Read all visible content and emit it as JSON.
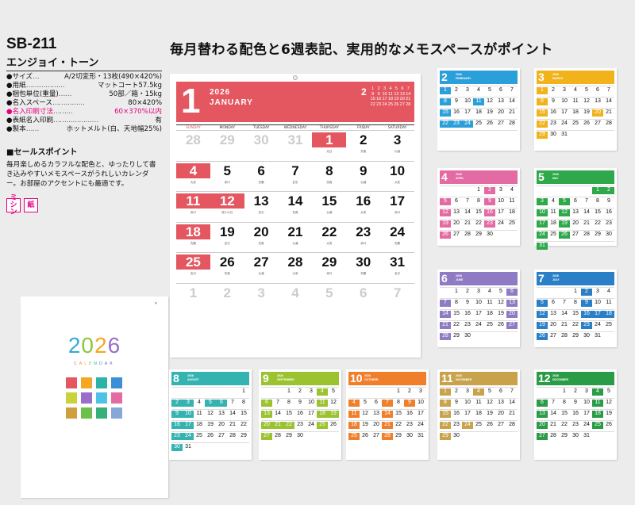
{
  "product": {
    "model": "SB-211",
    "name": "エンジョイ・トーン",
    "specs": [
      {
        "k": "●サイズ",
        "d": "…",
        "v": "A/2切変形・13枚(490×420%)"
      },
      {
        "k": "●用紙",
        "d": "………………",
        "v": "マットコート57.5kg"
      },
      {
        "k": "●梱包単位(重量)",
        "d": "……",
        "v": "50部／箱・15kg"
      },
      {
        "k": "●名入スペース",
        "d": "……………",
        "v": "80×420%"
      },
      {
        "k": "●名入印刷寸法",
        "d": "………",
        "v": "60×370%以内",
        "highlight": true
      },
      {
        "k": "●表紙名入印刷",
        "d": "…………………",
        "v": "有"
      },
      {
        "k": "●製本",
        "d": "……",
        "v": "ホットメルト(白、天地幅25%)"
      }
    ],
    "selling_point_title": "■セールスポイント",
    "selling_point_text": "毎月楽しめるカラフルな配色と、ゆったりして書き込みやすいメモスペースがうれしいカレンダー。お部屋のアクセントにも最適です。",
    "icons": [
      "ミシン",
      "紙"
    ]
  },
  "headline": "毎月替わる配色と6週表記、実用的なメモスペースがポイント",
  "cover": {
    "year": "2026",
    "year_colors": [
      "#3aa9d6",
      "#8cc63f",
      "#f4a71d",
      "#9b6fc9"
    ],
    "calendar_label": "CALENDAR",
    "label_colors": [
      "#e45761",
      "#f08a2e",
      "#f4c21d",
      "#8cc63f",
      "#2bb3a7",
      "#3a8fd6",
      "#5a6fd1",
      "#9b6fc9"
    ],
    "swatches": [
      "#e45761",
      "#f5a623",
      "#2bb3a7",
      "#3a8fd6",
      "#c9d23a",
      "#9b6fc9",
      "#4fc3e6",
      "#e46aa4",
      "#cf9f3c",
      "#6bbf4a",
      "#35b07a",
      "#86a8d8"
    ]
  },
  "main_calendar": {
    "year": "2026",
    "month_num": "1",
    "month_name": "JANUARY",
    "color": "#e45761",
    "next_month_num": "2",
    "next_month_days": [
      "",
      "",
      "",
      "",
      "",
      "",
      "",
      "1",
      "2",
      "3",
      "4",
      "5",
      "6",
      "7",
      "8",
      "9",
      "10",
      "11",
      "12",
      "13",
      "14",
      "15",
      "16",
      "17",
      "18",
      "19",
      "20",
      "21",
      "22",
      "23",
      "24",
      "25",
      "26",
      "27",
      "28"
    ],
    "weekdays": [
      "SUNDAY",
      "MONDAY",
      "TUESDAY",
      "WEDNESDAY",
      "THURSDAY",
      "FRIDAY",
      "SATURDAY"
    ],
    "days": [
      {
        "n": "28",
        "g": true
      },
      {
        "n": "29",
        "g": true
      },
      {
        "n": "30",
        "g": true
      },
      {
        "n": "31",
        "g": true
      },
      {
        "n": "1",
        "h": true,
        "l": "元日"
      },
      {
        "n": "2",
        "l": "先負"
      },
      {
        "n": "3",
        "l": "仏滅"
      },
      {
        "n": "4",
        "h": true,
        "l": "大安"
      },
      {
        "n": "5",
        "l": "赤口"
      },
      {
        "n": "6",
        "l": "先勝"
      },
      {
        "n": "7",
        "l": "友引"
      },
      {
        "n": "8",
        "l": "先負"
      },
      {
        "n": "9",
        "l": "仏滅"
      },
      {
        "n": "10",
        "l": "大安"
      },
      {
        "n": "11",
        "h": true,
        "l": "赤口"
      },
      {
        "n": "12",
        "h": true,
        "l": "成人の日"
      },
      {
        "n": "13",
        "l": "友引"
      },
      {
        "n": "14",
        "l": "先負"
      },
      {
        "n": "15",
        "l": "仏滅"
      },
      {
        "n": "16",
        "l": "大安"
      },
      {
        "n": "17",
        "l": "赤口"
      },
      {
        "n": "18",
        "h": true,
        "l": "先勝"
      },
      {
        "n": "19",
        "l": "友引"
      },
      {
        "n": "20",
        "l": "先負"
      },
      {
        "n": "21",
        "l": "仏滅"
      },
      {
        "n": "22",
        "l": "大安"
      },
      {
        "n": "23",
        "l": "赤口"
      },
      {
        "n": "24",
        "l": "先勝"
      },
      {
        "n": "25",
        "h": true,
        "l": "友引"
      },
      {
        "n": "26",
        "l": "先負"
      },
      {
        "n": "27",
        "l": "仏滅"
      },
      {
        "n": "28",
        "l": "大安"
      },
      {
        "n": "29",
        "l": "赤口"
      },
      {
        "n": "30",
        "l": "先勝"
      },
      {
        "n": "31",
        "l": "友引"
      },
      {
        "n": "1",
        "g": true
      },
      {
        "n": "2",
        "g": true
      },
      {
        "n": "3",
        "g": true
      },
      {
        "n": "4",
        "g": true
      },
      {
        "n": "5",
        "g": true
      },
      {
        "n": "6",
        "g": true
      },
      {
        "n": "7",
        "g": true
      }
    ]
  },
  "months": [
    {
      "num": "2",
      "name": "FEBRUARY",
      "color": "#2b9fd9",
      "start": 0,
      "days": 28,
      "hol": [
        0,
        7,
        10,
        14,
        21,
        22,
        23
      ]
    },
    {
      "num": "3",
      "name": "MARCH",
      "color": "#f1b21b",
      "start": 0,
      "days": 31,
      "hol": [
        0,
        7,
        14,
        19,
        21,
        28
      ]
    },
    {
      "num": "4",
      "name": "APRIL",
      "color": "#e46aa4",
      "start": 3,
      "days": 30,
      "hol": [
        4,
        11,
        18,
        25,
        28
      ]
    },
    {
      "num": "5",
      "name": "MAY",
      "color": "#2ea84a",
      "start": 5,
      "days": 31,
      "hol": [
        2,
        3,
        4,
        5,
        6,
        9,
        16,
        23,
        30
      ]
    },
    {
      "num": "6",
      "name": "JUNE",
      "color": "#8f7bc4",
      "start": 1,
      "days": 30,
      "hol": [
        6,
        13,
        20,
        27
      ]
    },
    {
      "num": "7",
      "name": "JULY",
      "color": "#2b7fc7",
      "start": 3,
      "days": 31,
      "hol": [
        4,
        11,
        18,
        19,
        20,
        25
      ]
    },
    {
      "num": "8",
      "name": "AUGUST",
      "color": "#34b3b0",
      "start": 6,
      "days": 31,
      "hol": [
        1,
        8,
        10,
        11,
        15,
        22,
        29
      ]
    },
    {
      "num": "9",
      "name": "SEPTEMBER",
      "color": "#9bc22f",
      "start": 2,
      "days": 30,
      "hol": [
        5,
        12,
        19,
        20,
        21,
        22,
        23,
        26
      ]
    },
    {
      "num": "10",
      "name": "OCTOBER",
      "color": "#f07f2c",
      "start": 4,
      "days": 31,
      "hol": [
        3,
        10,
        12,
        17,
        24,
        31
      ]
    },
    {
      "num": "11",
      "name": "NOVEMBER",
      "color": "#c8a34c",
      "start": 0,
      "days": 30,
      "hol": [
        0,
        3,
        7,
        14,
        21,
        23,
        28
      ]
    },
    {
      "num": "12",
      "name": "DECEMBER",
      "color": "#2a9c47",
      "start": 2,
      "days": 31,
      "hol": [
        5,
        12,
        19,
        26
      ]
    }
  ]
}
